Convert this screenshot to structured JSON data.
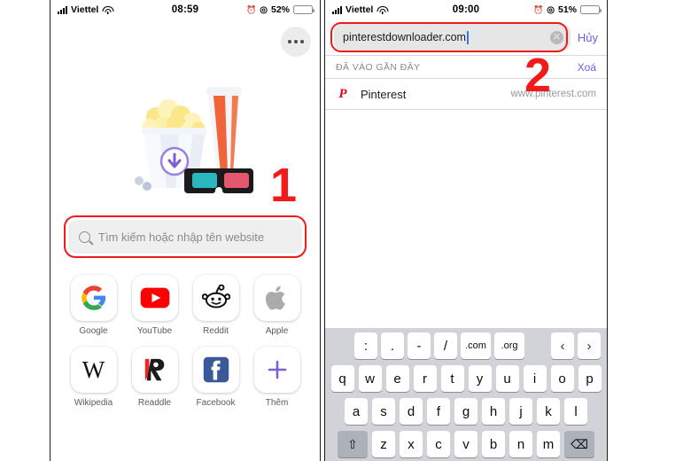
{
  "left_phone": {
    "status_bar": {
      "carrier": "Viettel",
      "time": "08:59",
      "battery_pct": "52%",
      "alarm_icon": "alarm-clock-icon",
      "location_icon": "location-services-icon",
      "wifi_icon": "wifi-icon",
      "signal_icon": "cellular-signal-icon"
    },
    "menu_button": "more-options-icon",
    "hero_illustration": "popcorn-soda-3dglasses-download-illustration",
    "search": {
      "placeholder": "Tìm kiếm hoặc nhập tên website",
      "icon": "search-icon"
    },
    "annotation": "1",
    "favorites": [
      {
        "label": "Google",
        "icon": "google-logo"
      },
      {
        "label": "YouTube",
        "icon": "youtube-logo"
      },
      {
        "label": "Reddit",
        "icon": "reddit-logo"
      },
      {
        "label": "Apple",
        "icon": "apple-logo"
      },
      {
        "label": "Wikipedia",
        "icon": "wikipedia-logo"
      },
      {
        "label": "Readdle",
        "icon": "readdle-logo"
      },
      {
        "label": "Facebook",
        "icon": "facebook-logo"
      },
      {
        "label": "Thêm",
        "icon": "plus-icon"
      }
    ]
  },
  "right_phone": {
    "status_bar": {
      "carrier": "Viettel",
      "time": "09:00",
      "battery_pct": "51%",
      "alarm_icon": "alarm-clock-icon",
      "location_icon": "location-services-icon",
      "wifi_icon": "wifi-icon",
      "signal_icon": "cellular-signal-icon"
    },
    "url_bar": {
      "value": "pinterestdownloader.com",
      "clear_icon": "clear-text-icon",
      "cancel_label": "Hủy"
    },
    "annotation": "2",
    "recent": {
      "section_title": "ĐÃ VÀO GẦN ĐÂY",
      "clear_label": "Xoá",
      "items": [
        {
          "icon": "pinterest-logo",
          "title": "Pinterest",
          "url": "www.pinterest.com"
        }
      ]
    },
    "keyboard": {
      "accessory_row": [
        ":",
        ".",
        "-",
        "/",
        ".com",
        ".org"
      ],
      "nav_prev": "‹",
      "nav_next": "›",
      "row1": [
        "q",
        "w",
        "e",
        "r",
        "t",
        "y",
        "u",
        "i",
        "o",
        "p"
      ],
      "row2": [
        "a",
        "s",
        "d",
        "f",
        "g",
        "h",
        "j",
        "k",
        "l"
      ],
      "row3": [
        "z",
        "x",
        "c",
        "v",
        "b",
        "n",
        "m"
      ],
      "shift_key": "⇧",
      "delete_key": "⌫"
    }
  },
  "colors": {
    "annotation_red": "#f21a1a",
    "accent_purple": "#6d5ce7",
    "battery_yellow": "#fdc500",
    "pinterest_red": "#e60023"
  }
}
